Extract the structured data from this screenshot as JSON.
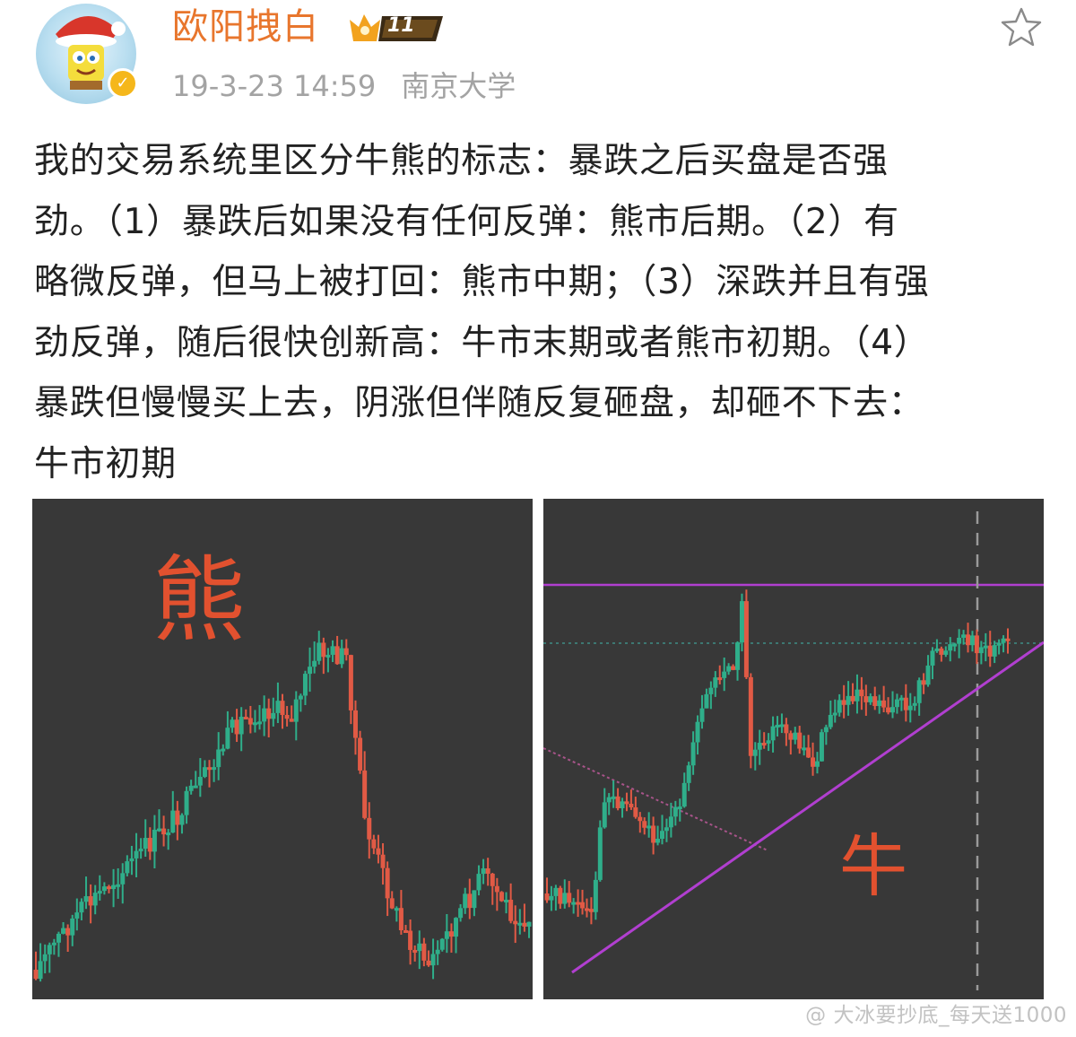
{
  "user": {
    "name": "欧阳拽白",
    "vip_level": "11",
    "timestamp": "19-3-23 14:59",
    "source": "南京大学"
  },
  "post": {
    "lines": [
      "我的交易系统里区分牛熊的标志：暴跌之后买盘是否强",
      "劲。（1）暴跌后如果没有任何反弹：熊市后期。（2）有",
      "略微反弹，但马上被打回：熊市中期；（3）深跌并且有强",
      "劲反弹，随后很快创新高：牛市末期或者熊市初期。（4）",
      "暴跌但慢慢买上去，阴涨但伴随反复砸盘，却砸不下去：",
      "牛市初期"
    ]
  },
  "images": {
    "bear_label": "熊",
    "bull_label": "牛"
  },
  "watermark": "@ 大冰要抄底_每天送1000",
  "colors": {
    "username": "#e8762d",
    "candle_up": "#2fae8a",
    "candle_down": "#e15a45",
    "trendline": "#b13fd0",
    "chart_background": "#383838"
  },
  "icons": [
    "avatar",
    "verified-icon",
    "vip-crown-icon",
    "star-icon"
  ]
}
